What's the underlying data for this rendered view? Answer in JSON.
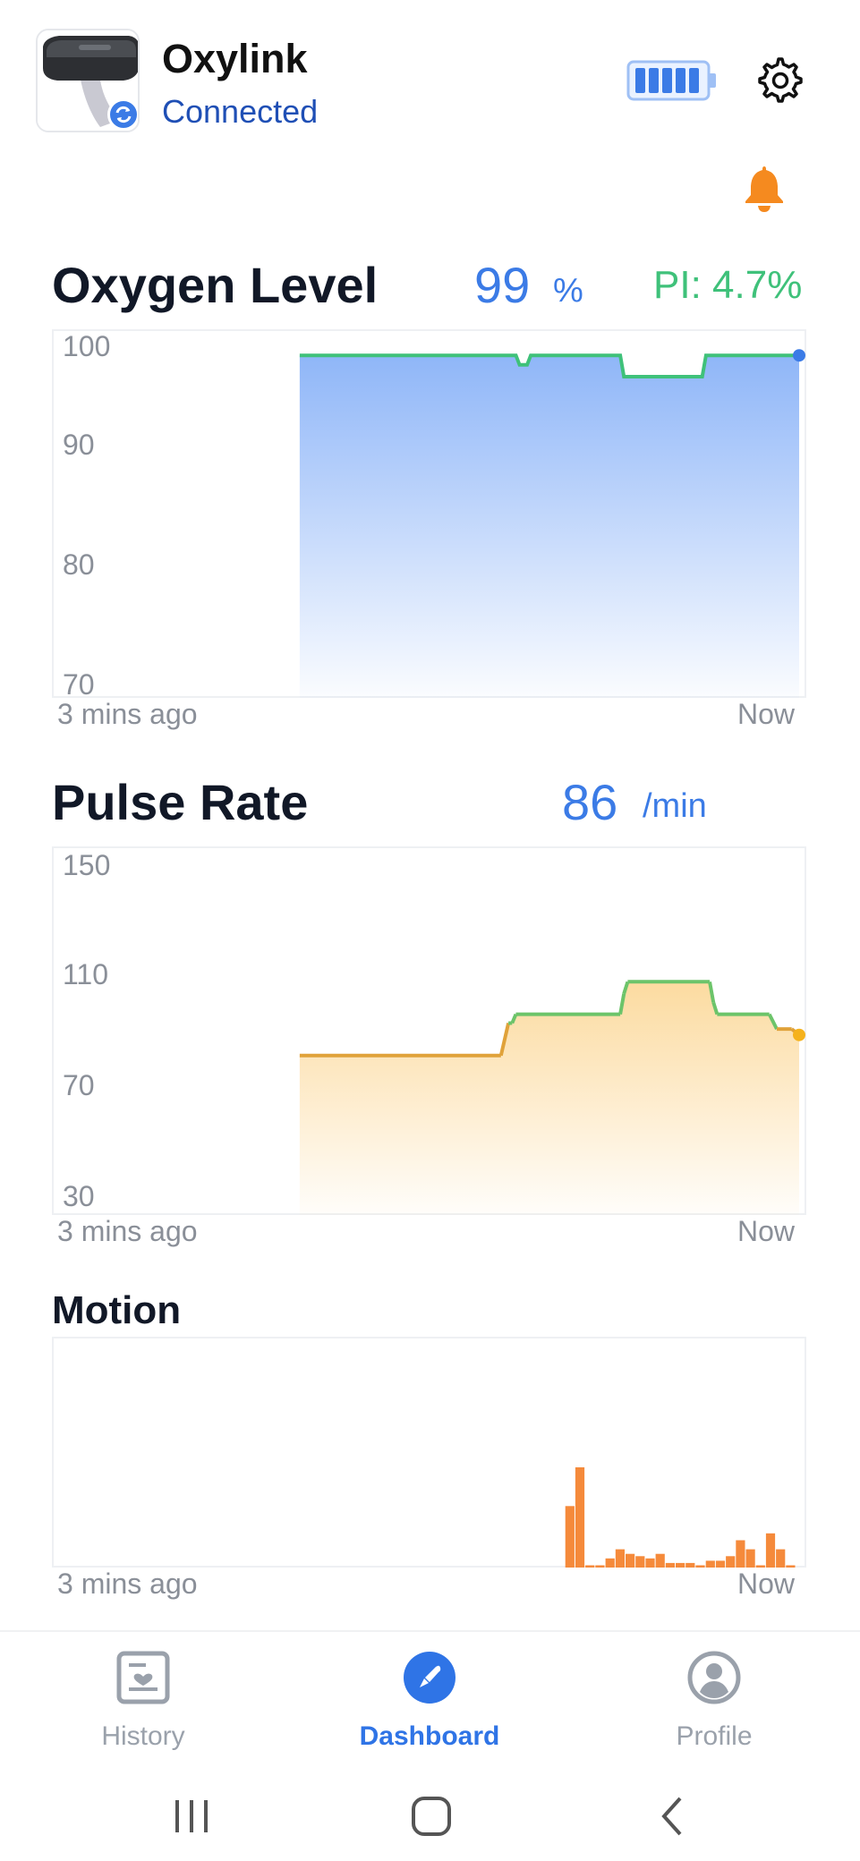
{
  "header": {
    "device_name": "Oxylink",
    "status": "Connected",
    "icons": {
      "battery": "battery-full-icon",
      "settings": "gear-icon",
      "alarm": "bell-icon",
      "sync": "sync-icon"
    },
    "battery_level": 1.0
  },
  "oxygen": {
    "title": "Oxygen Level",
    "value": "99",
    "unit": "%",
    "pi_label": "PI: 4.7%",
    "start_label": "3 mins ago",
    "end_label": "Now"
  },
  "pulse": {
    "title": "Pulse Rate",
    "value": "86",
    "unit": "/min",
    "start_label": "3 mins ago",
    "end_label": "Now"
  },
  "motion": {
    "title": "Motion",
    "start_label": "3 mins ago",
    "end_label": "Now"
  },
  "nav": {
    "history": "History",
    "dashboard": "Dashboard",
    "profile": "Profile",
    "active": "dashboard"
  },
  "colors": {
    "accent": "#3b7be6",
    "pi_green": "#3fc17a",
    "alarm_orange": "#f58a1f",
    "motion_bar": "#f58a3b",
    "spo2_fill": "#8fb6f8",
    "pulse_fill": "#fcdba0"
  },
  "chart_data": [
    {
      "type": "area",
      "name": "oxygen",
      "y_ticks": [
        "100",
        "90",
        "80",
        "70"
      ],
      "ylim": [
        70,
        100
      ],
      "x": [
        0.33,
        0.34,
        0.62,
        0.625,
        0.635,
        0.64,
        0.76,
        0.765,
        0.87,
        0.875,
        0.99,
        1.0
      ],
      "y": [
        99,
        99,
        99,
        98.2,
        98.2,
        99,
        99,
        97.2,
        97.2,
        99,
        99,
        99
      ],
      "x_start": "3 mins ago",
      "x_end": "Now",
      "grid": false
    },
    {
      "type": "area",
      "name": "pulse",
      "y_ticks": [
        "150",
        "110",
        "70",
        "30"
      ],
      "ylim": [
        30,
        150
      ],
      "x": [
        0.33,
        0.6,
        0.61,
        0.615,
        0.62,
        0.76,
        0.765,
        0.77,
        0.88,
        0.885,
        0.89,
        0.96,
        0.97,
        0.99,
        1.0
      ],
      "y": [
        84,
        84,
        95,
        95,
        98,
        98,
        105,
        109,
        109,
        102,
        98,
        98,
        93,
        93,
        91
      ],
      "x_start": "3 mins ago",
      "x_end": "Now",
      "grid": false
    },
    {
      "type": "bar",
      "name": "motion",
      "x_start": "3 mins ago",
      "x_end": "Now",
      "values": [
        0,
        0,
        0,
        0,
        0,
        0,
        0,
        0,
        0,
        0,
        0,
        0,
        0,
        0,
        0,
        0,
        0,
        0,
        0,
        0,
        0,
        0,
        0,
        0,
        0,
        0,
        0,
        0,
        0,
        0,
        0,
        0,
        0,
        0,
        0,
        0,
        0,
        0,
        0,
        0,
        0,
        0,
        0,
        0,
        0,
        0,
        0,
        0,
        0,
        0,
        0,
        27,
        44,
        1,
        1,
        4,
        8,
        6,
        5,
        4,
        6,
        2,
        2,
        2,
        1,
        3,
        3,
        5,
        12,
        8,
        1,
        15,
        8,
        1
      ]
    }
  ]
}
